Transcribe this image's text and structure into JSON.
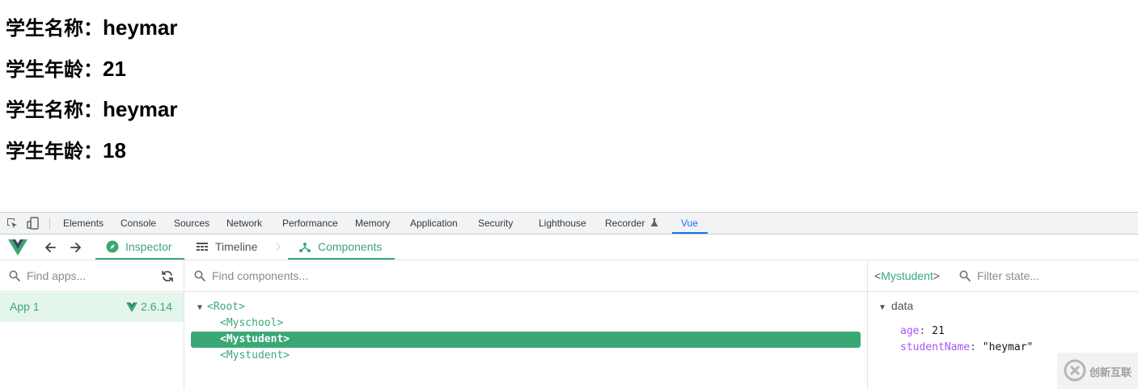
{
  "page": {
    "lines": [
      {
        "label": "学生名称：",
        "value": "heymar"
      },
      {
        "label": "学生年龄：",
        "value": "21"
      },
      {
        "label": "学生名称：",
        "value": "heymar"
      },
      {
        "label": "学生年龄：",
        "value": "18"
      }
    ]
  },
  "devtools": {
    "tabs": [
      "Elements",
      "Console",
      "Sources",
      "Network",
      "Performance",
      "Memory",
      "Application",
      "Security",
      "Lighthouse",
      "Recorder",
      "Vue"
    ],
    "active_tab": "Vue"
  },
  "vue_toolbar": {
    "inspector_label": "Inspector",
    "timeline_label": "Timeline",
    "components_label": "Components"
  },
  "apps_pane": {
    "search_placeholder": "Find apps...",
    "app_name": "App 1",
    "vue_version": "2.6.14"
  },
  "tree_pane": {
    "search_placeholder": "Find components...",
    "nodes": [
      {
        "label": "<Root>",
        "expanded": true
      },
      {
        "label": "<Myschool>"
      },
      {
        "label": "<Mystudent>",
        "selected": true
      },
      {
        "label": "<Mystudent>"
      }
    ]
  },
  "state_pane": {
    "component_lt": "<",
    "component_name": "Mystudent",
    "component_gt": ">",
    "filter_placeholder": "Filter state...",
    "section": "data",
    "props": [
      {
        "key": "age",
        "value": "21"
      },
      {
        "key": "studentName",
        "value": "\"heymar\""
      }
    ]
  },
  "watermark": {
    "text": "创新互联"
  },
  "colors": {
    "vue_green": "#3ba776",
    "devtools_blue": "#1a73e8"
  }
}
